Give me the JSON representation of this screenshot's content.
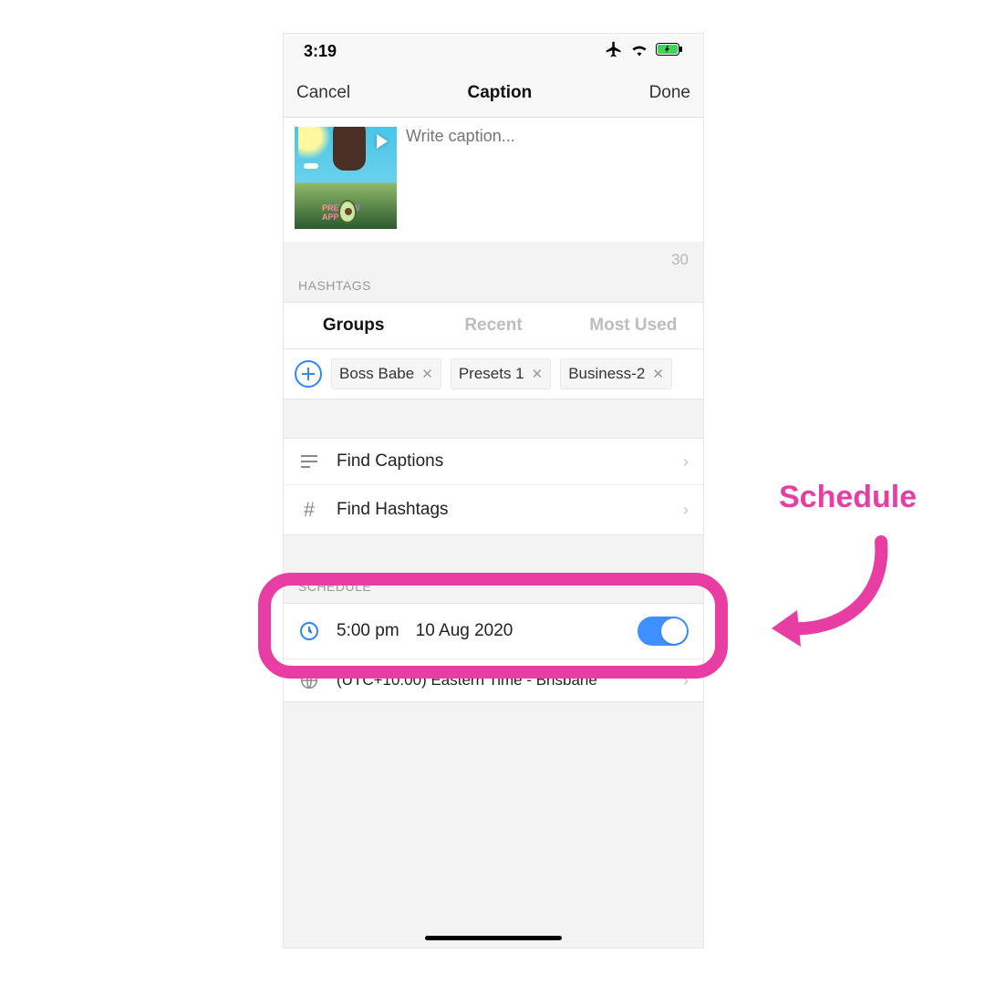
{
  "status": {
    "time": "3:19"
  },
  "nav": {
    "cancel": "Cancel",
    "title": "Caption",
    "done": "Done"
  },
  "caption": {
    "placeholder": "Write caption...",
    "thumb_label": "PREVIEW APP",
    "count": "30"
  },
  "hashtags": {
    "section_label": "HASHTAGS",
    "tabs": {
      "groups": "Groups",
      "recent": "Recent",
      "most_used": "Most Used"
    },
    "chips": [
      "Boss Babe",
      "Presets 1",
      "Business-2"
    ]
  },
  "rows": {
    "find_captions": "Find Captions",
    "find_hashtags": "Find Hashtags"
  },
  "schedule": {
    "section_label": "SCHEDULE",
    "time": "5:00 pm",
    "date": "10 Aug 2020",
    "timezone": "(UTC+10:00) Eastern Time - Brisbane",
    "toggle_on": true
  },
  "callout": {
    "label": "Schedule"
  }
}
